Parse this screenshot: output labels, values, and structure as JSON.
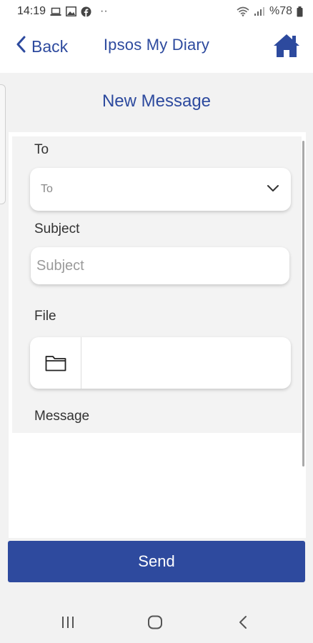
{
  "status_bar": {
    "time": "14:19",
    "battery": "%78",
    "more": "··"
  },
  "header": {
    "back_label": "Back",
    "title": "Ipsos My Diary"
  },
  "page": {
    "title": "New Message"
  },
  "form": {
    "to_label": "To",
    "to_value": "To",
    "subject_label": "Subject",
    "subject_placeholder": "Subject",
    "file_label": "File",
    "message_label": "Message"
  },
  "actions": {
    "send_label": "Send"
  },
  "colors": {
    "brand": "#2e4a9e"
  },
  "icons": [
    "laptop-icon",
    "image-icon",
    "facebook-icon",
    "wifi-icon",
    "signal-icon",
    "battery-icon",
    "chevron-left-icon",
    "home-icon",
    "chevron-down-icon",
    "folder-icon",
    "recent-apps-icon",
    "home-circle-icon",
    "nav-back-icon"
  ]
}
